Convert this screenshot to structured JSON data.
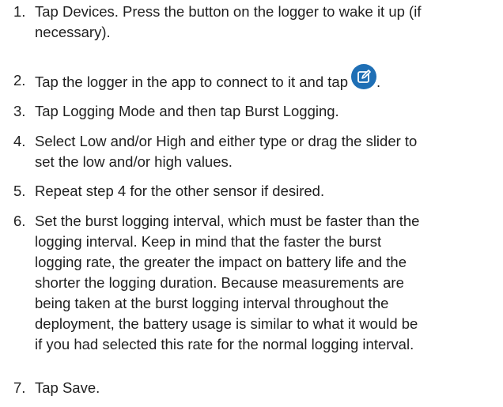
{
  "steps": [
    {
      "number": "1.",
      "lines": [
        "Tap Devices. Press the button on the logger to wake it up (if",
        "necessary)."
      ]
    },
    {
      "number": "2.",
      "before_icon": "Tap the logger in the app to connect to it and tap",
      "icon": "edit-icon",
      "after_icon": "."
    },
    {
      "number": "3.",
      "lines": [
        "Tap Logging Mode and then tap Burst Logging."
      ]
    },
    {
      "number": "4.",
      "lines": [
        "Select Low and/or High and either type or drag the slider to",
        "set the low and/or high values."
      ]
    },
    {
      "number": "5.",
      "lines": [
        "Repeat step 4 for the other sensor if desired."
      ]
    },
    {
      "number": "6.",
      "lines": [
        "Set the burst logging interval, which must be faster than the",
        "logging interval. Keep in mind that the faster the burst",
        "logging rate, the greater the impact on battery life and the",
        "shorter the logging duration. Because measurements are",
        "being taken at the burst logging interval throughout the",
        "deployment, the battery usage is similar to what it would be",
        "if you had selected this rate for the normal logging interval."
      ]
    },
    {
      "number": "7.",
      "lines": [
        "Tap Save."
      ]
    }
  ],
  "colors": {
    "text": "#1f1f1f",
    "icon_background": "#1f6fb5",
    "icon_foreground": "#ffffff"
  }
}
